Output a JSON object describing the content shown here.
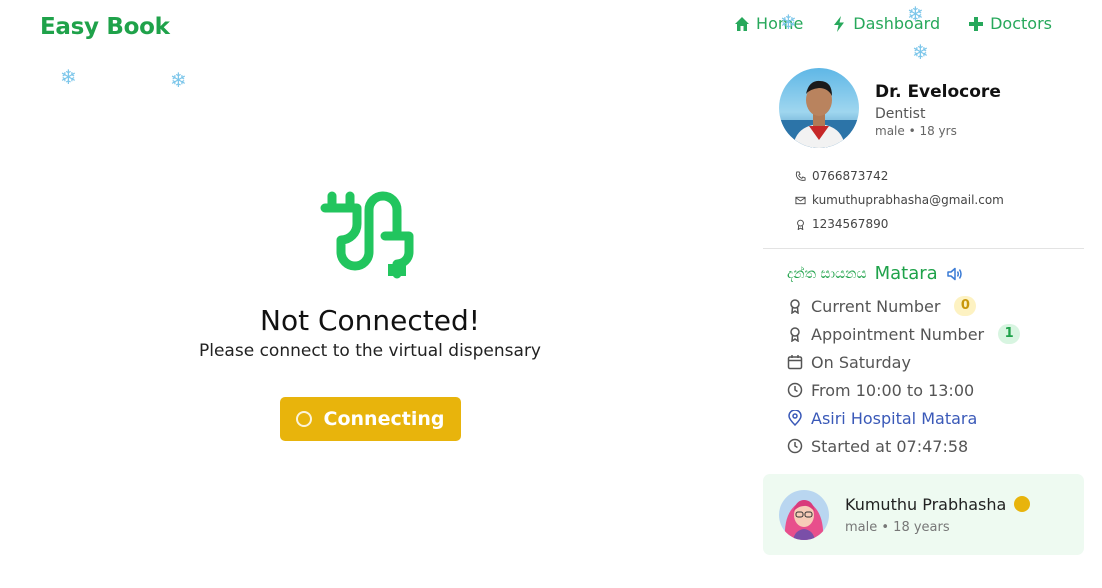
{
  "brand": "Easy Book",
  "nav": [
    {
      "label": "Home",
      "icon": "home-icon"
    },
    {
      "label": "Dashboard",
      "icon": "lightning-icon"
    },
    {
      "label": "Doctors",
      "icon": "plus-icon"
    }
  ],
  "status": {
    "title": "Not Connected!",
    "subtitle": "Please connect to the virtual dispensary",
    "button_label": "Connecting"
  },
  "doctor": {
    "name": "Dr. Evelocore",
    "specialty": "Dentist",
    "meta": "male • 18 yrs",
    "phone": "0766873742",
    "email": "kumuthuprabhasha@gmail.com",
    "license": "1234567890"
  },
  "clinic": {
    "label_sinhala": "දන්ත සායනය",
    "city": "Matara"
  },
  "session": {
    "current_number_label": "Current Number",
    "current_number": "0",
    "appointment_number_label": "Appointment Number",
    "appointment_number": "1",
    "day": "On Saturday",
    "time": "From 10:00 to 13:00",
    "hospital": "Asiri Hospital Matara",
    "started": "Started at 07:47:58"
  },
  "patient": {
    "name": "Kumuthu Prabhasha",
    "meta": "male • 18 years"
  },
  "colors": {
    "brand_green": "#1fa24a",
    "button_yellow": "#e8b40c",
    "link_blue": "#3a59b8",
    "patient_bg": "#eefaf1"
  }
}
